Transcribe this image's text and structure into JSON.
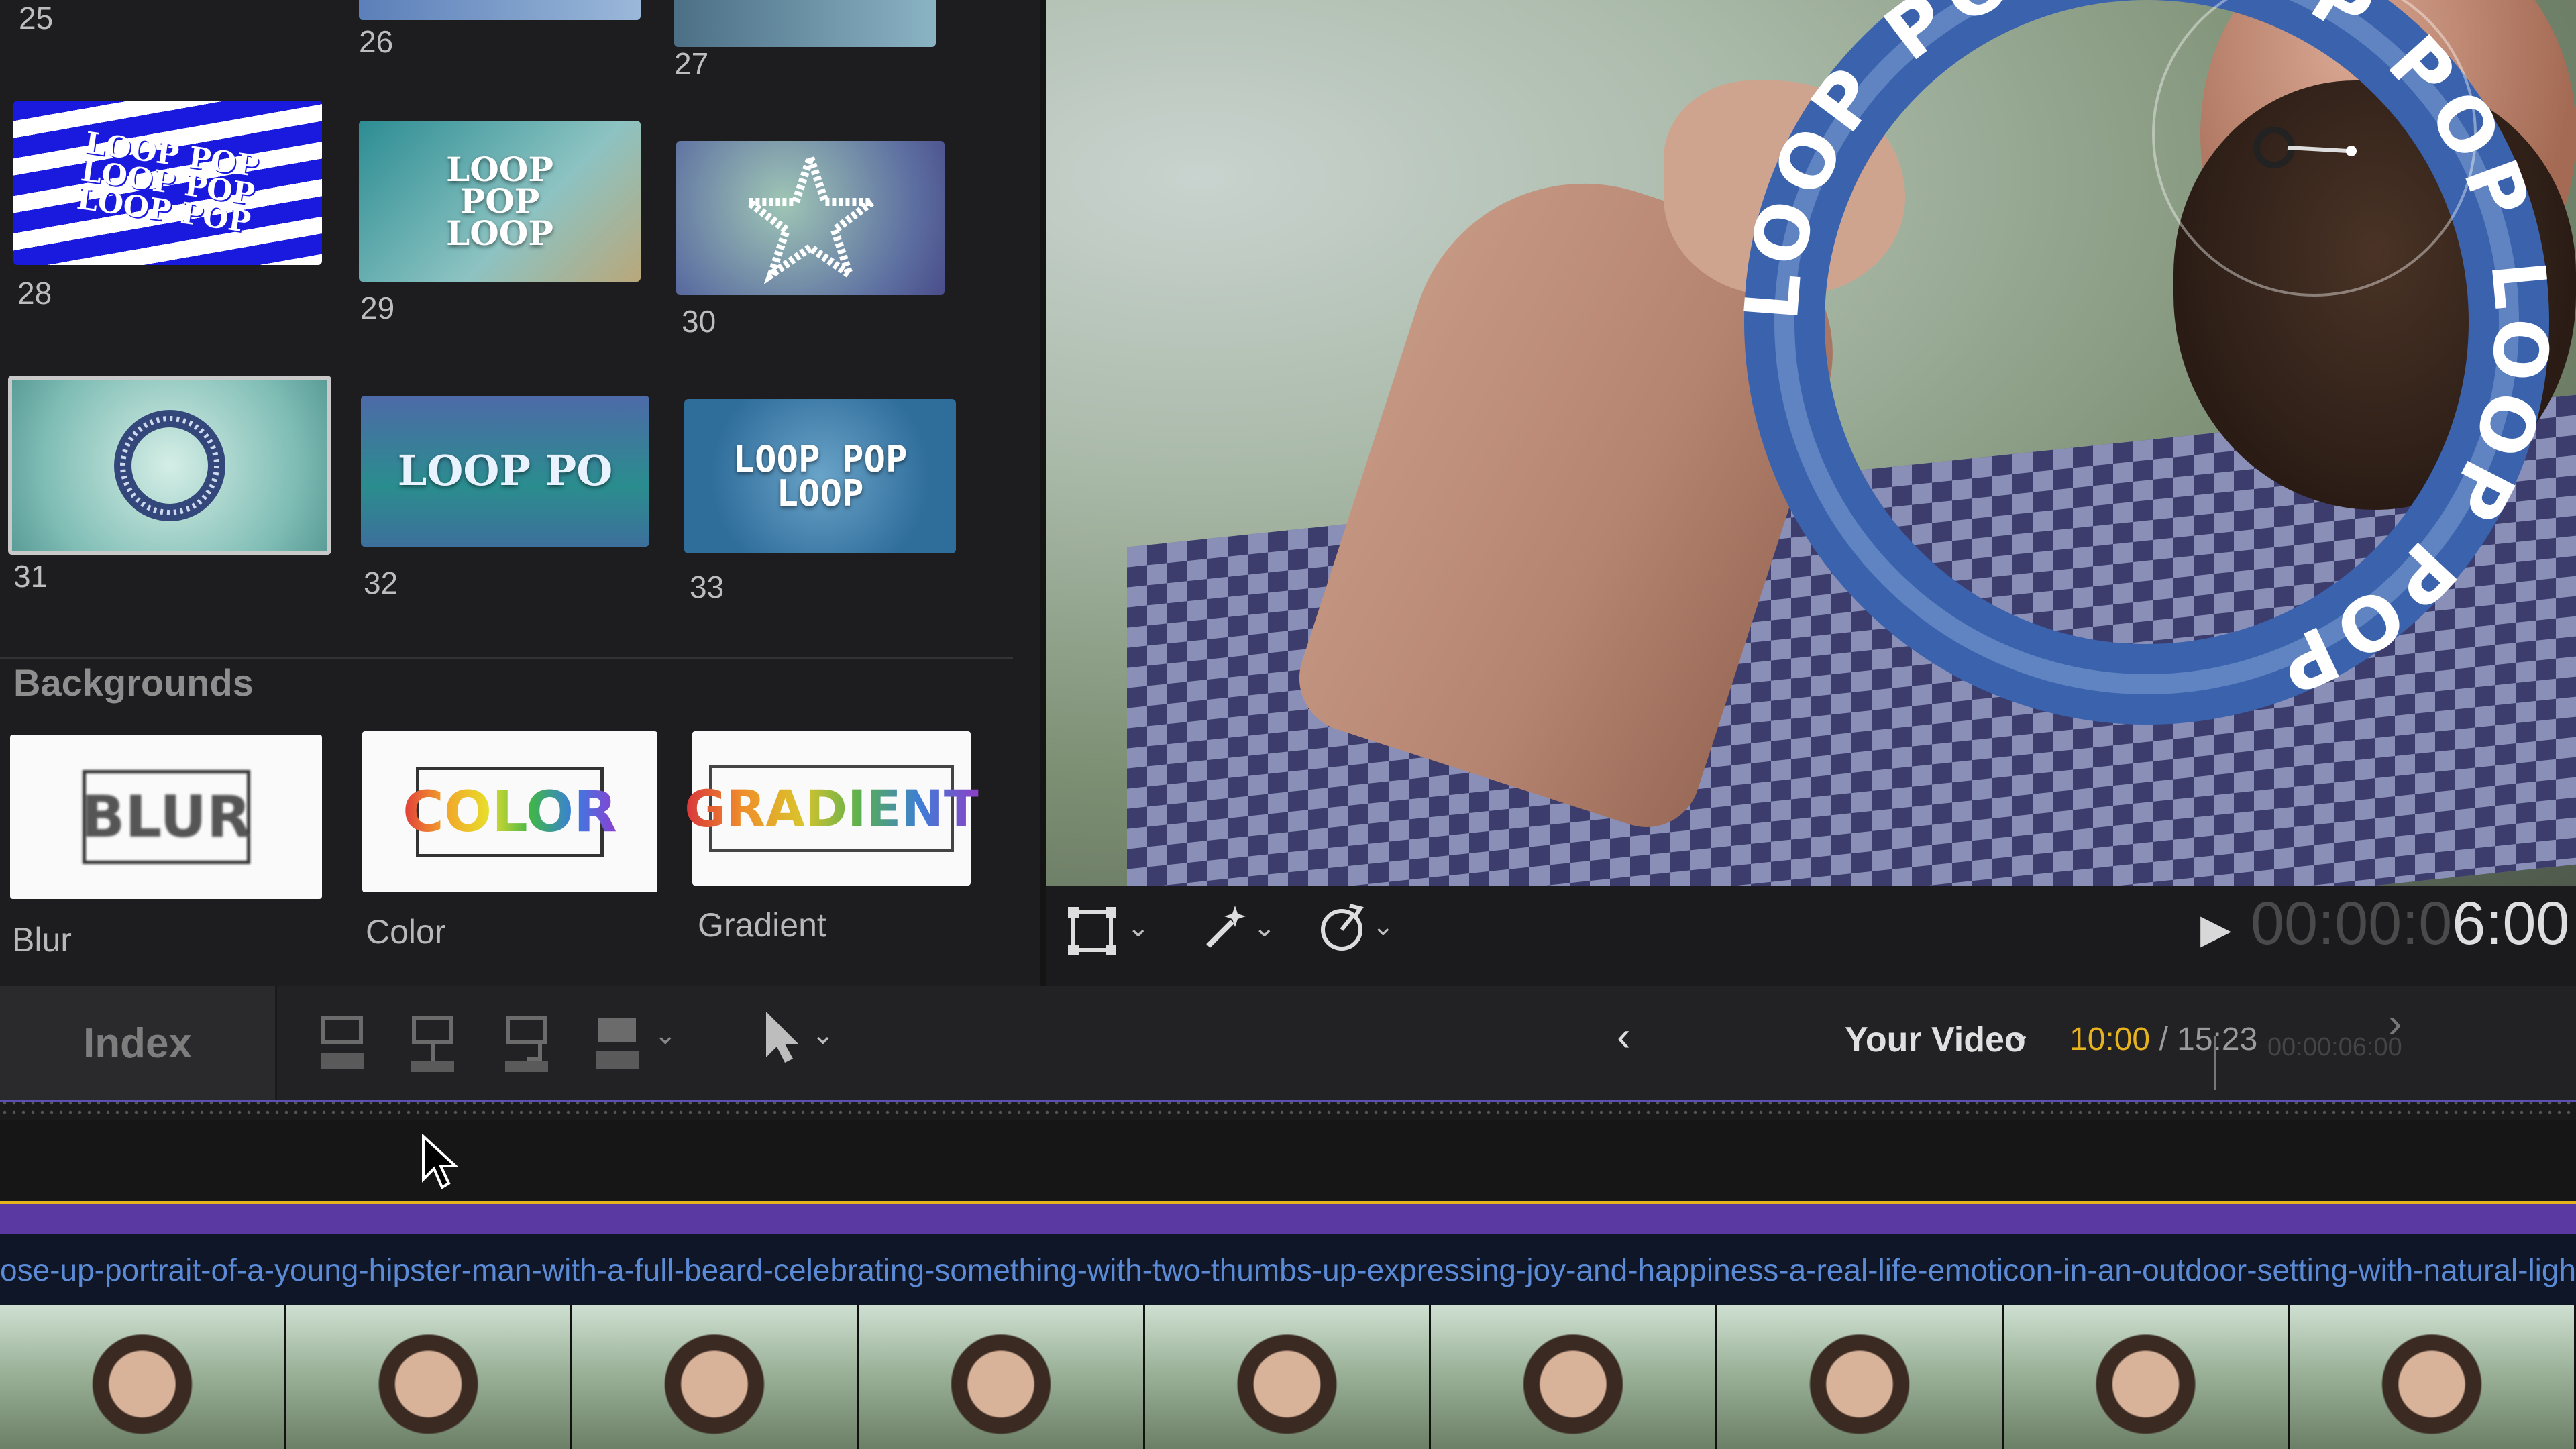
{
  "browser": {
    "top_numbers": [
      "25",
      "26",
      "27"
    ],
    "tiles": [
      {
        "num": "28",
        "text": "LOOP POP LOOP POP LOOP POP",
        "style": "wave-blue"
      },
      {
        "num": "29",
        "text": "LOOP POP LOOP",
        "style": "stack-teal"
      },
      {
        "num": "30",
        "text": "LOOP POP LOOP",
        "style": "star"
      },
      {
        "num": "31",
        "text": "",
        "style": "ring-selected"
      },
      {
        "num": "32",
        "text": "LOOP PO",
        "style": "split"
      },
      {
        "num": "33",
        "text": "LOOP POP LOOP",
        "style": "spiral"
      }
    ],
    "backgrounds_header": "Backgrounds",
    "backgrounds": [
      {
        "tile_text": "BLUR",
        "label": "Blur"
      },
      {
        "tile_text": "COLOR",
        "label": "Color"
      },
      {
        "tile_text": "GRADIENT",
        "label": "Gradient"
      }
    ]
  },
  "viewer": {
    "ring_text": "LOOP POP LOOP POP LOOP POP",
    "ring_color": "#3a62ad",
    "timecode_dim": "00:00:0",
    "timecode_lit": "6:00"
  },
  "viewer_bar": {
    "icons": [
      "transform-icon",
      "enhance-wand-icon",
      "speed-gauge-icon"
    ]
  },
  "toolbar": {
    "index_label": "Index",
    "edit_buttons": [
      "connect-icon",
      "insert-icon",
      "append-icon",
      "overwrite-icon"
    ],
    "tool_icon": "arrow-select-icon",
    "project_name": "Your Video",
    "duration_current": "10:00",
    "duration_sep": " / ",
    "duration_total": "15:23"
  },
  "ruler_time": "00:00:06:00",
  "clip": {
    "label": "ose-up-portrait-of-a-young-hipster-man-with-a-full-beard-celebrating-something-with-two-thumbs-up-expressing-joy-and-happiness-a-real-life-emoticon-in-an-outdoor-setting-with-natural-lighting-and"
  },
  "colors": {
    "accent_purple": "#5a39a3",
    "accent_yellow": "#e6b21e",
    "clip_blue": "#5b8bd6"
  }
}
